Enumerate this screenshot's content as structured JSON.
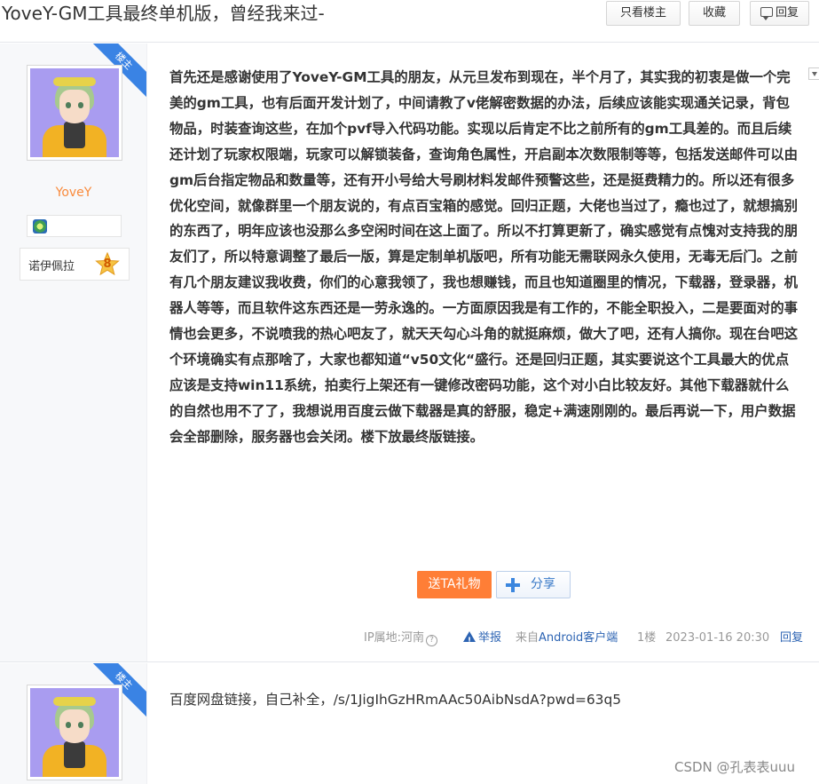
{
  "header": {
    "title": "YoveY-GM工具最终单机版，曾经我来过-",
    "only_author_label": "只看楼主",
    "favorite_label": "收藏",
    "reply_label": "回复"
  },
  "colors": {
    "accent_blue": "#2d64b3",
    "gift_orange": "#ff7e36",
    "username_orange": "#f98a3b",
    "ribbon_blue": "#3a83e4"
  },
  "post1": {
    "ribbon": "楼主",
    "username": "YoveY",
    "rank_label": "诺伊佩拉",
    "rank_level": "8",
    "text": "首先还是感谢使用了YoveY-GM工具的朋友，从元旦发布到现在，半个月了，其实我的初衷是做一个完美的gm工具，也有后面开发计划了，中间请教了v佬解密数据的办法，后续应该能实现通关记录，背包物品，时装查询这些，在加个pvf导入代码功能。实现以后肯定不比之前所有的gm工具差的。而且后续还计划了玩家权限端，玩家可以解锁装备，查询角色属性，开启副本次数限制等等，包括发送邮件可以由gm后台指定物品和数量等，还有开小号给大号刷材料发邮件预警这些，还是挺费精力的。所以还有很多优化空间，就像群里一个朋友说的，有点百宝箱的感觉。回归正题，大佬也当过了，瘾也过了，就想搞别的东西了，明年应该也没那么多空闲时间在这上面了。所以不打算更新了，确实感觉有点愧对支持我的朋友们了，所以特意调整了最后一版，算是定制单机版吧，所有功能无需联网永久使用，无毒无后门。之前有几个朋友建议我收费，你们的心意我领了，我也想赚钱，而且也知道圈里的情况，下载器，登录器，机器人等等，而且软件这东西还是一劳永逸的。一方面原因我是有工作的，不能全职投入，二是要面对的事情也会更多，不说喷我的热心吧友了，就天天勾心斗角的就挺麻烦，做大了吧，还有人搞你。现在台吧这个环境确实有点那啥了，大家也都知道“v50文化“盛行。还是回归正题，其实要说这个工具最大的优点应该是支持win11系统，拍卖行上架还有一键修改密码功能，这个对小白比较友好。其他下载器就什么的自然也用不了了，我想说用百度云做下载器是真的舒服，稳定+满速刚刚的。最后再说一下，用户数据会全部删除，服务器也会关闭。楼下放最终版链接。",
    "gift_label": "送TA礼物",
    "share_label": "分享",
    "ip_location": "IP属地:河南",
    "report_label": "举报",
    "source_prefix": "来自",
    "source_client": "Android客户端",
    "floor": "1楼",
    "timestamp": "2023-01-16 20:30",
    "reply_label": "回复"
  },
  "post2": {
    "ribbon": "楼主",
    "text": "百度网盘链接，自己补全，/s/1JigIhGzHRmAAc50AibNsdA?pwd=63q5"
  },
  "watermark": "CSDN @孔表表uuu"
}
